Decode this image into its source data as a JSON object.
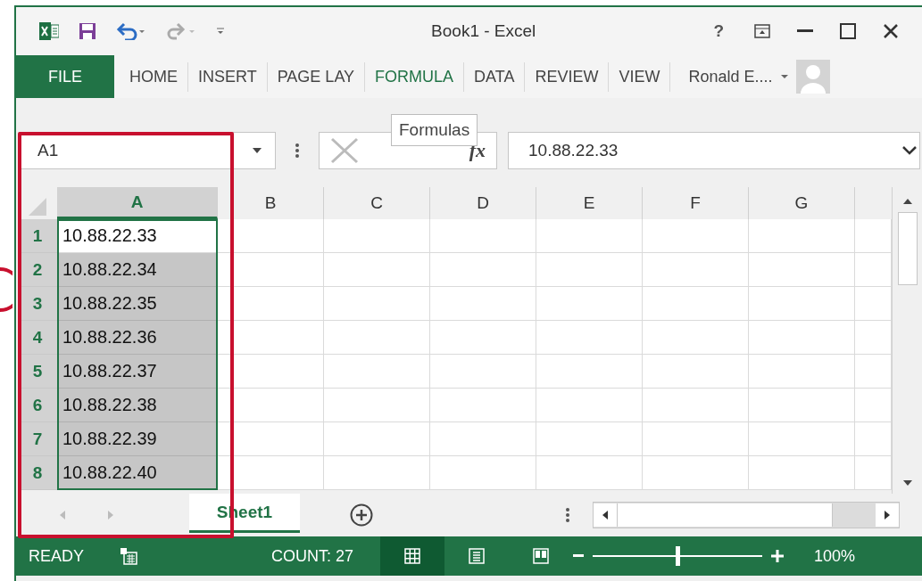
{
  "window": {
    "title": "Book1 - Excel",
    "help": "?"
  },
  "ribbon": {
    "file": "FILE",
    "tabs": [
      {
        "label": "HOME",
        "selected": false
      },
      {
        "label": "INSERT",
        "selected": false
      },
      {
        "label": "PAGE LAY",
        "selected": false
      },
      {
        "label": "FORMULA",
        "selected": true
      },
      {
        "label": "DATA",
        "selected": false
      },
      {
        "label": "REVIEW",
        "selected": false
      },
      {
        "label": "VIEW",
        "selected": false
      }
    ],
    "user": "Ronald E...."
  },
  "tooltip": "Formulas",
  "formula_bar": {
    "name_box": "A1",
    "fx": "fx",
    "value": "10.88.22.33"
  },
  "columns": [
    {
      "label": "A",
      "selected": true
    },
    {
      "label": "B",
      "selected": false
    },
    {
      "label": "C",
      "selected": false
    },
    {
      "label": "D",
      "selected": false
    },
    {
      "label": "E",
      "selected": false
    },
    {
      "label": "F",
      "selected": false
    },
    {
      "label": "G",
      "selected": false
    }
  ],
  "rows": [
    {
      "number": "1",
      "selected": true,
      "value": "10.88.22.33",
      "active": true
    },
    {
      "number": "2",
      "selected": true,
      "value": "10.88.22.34",
      "active": false
    },
    {
      "number": "3",
      "selected": true,
      "value": "10.88.22.35",
      "active": false
    },
    {
      "number": "4",
      "selected": true,
      "value": "10.88.22.36",
      "active": false
    },
    {
      "number": "5",
      "selected": true,
      "value": "10.88.22.37",
      "active": false
    },
    {
      "number": "6",
      "selected": true,
      "value": "10.88.22.38",
      "active": false
    },
    {
      "number": "7",
      "selected": true,
      "value": "10.88.22.39",
      "active": false
    },
    {
      "number": "8",
      "selected": true,
      "value": "10.88.22.40",
      "active": false
    }
  ],
  "sheets": [
    {
      "label": "Sheet1",
      "selected": true
    }
  ],
  "status_bar": {
    "mode": "READY",
    "count": "COUNT: 27",
    "views": [
      {
        "kind": "normal",
        "selected": true
      },
      {
        "kind": "layout",
        "selected": false
      },
      {
        "kind": "break",
        "selected": false
      }
    ],
    "zoom": {
      "level": 0.5,
      "reading": "100%"
    }
  }
}
